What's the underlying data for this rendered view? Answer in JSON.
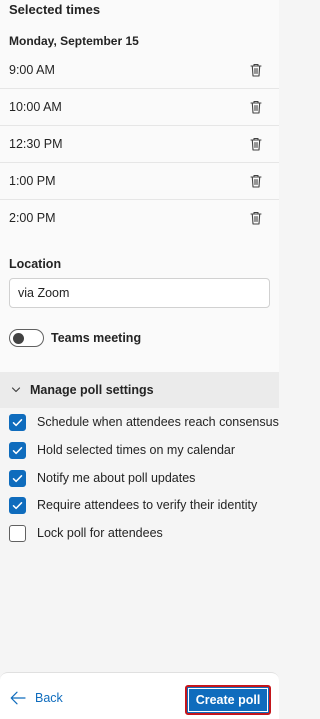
{
  "selected_times": {
    "title": "Selected times",
    "date": "Monday, September 15",
    "times": [
      "9:00 AM",
      "10:00 AM",
      "12:30 PM",
      "1:00 PM",
      "2:00 PM"
    ],
    "remove_icon": "trash-icon"
  },
  "location": {
    "label": "Location",
    "value": "via Zoom"
  },
  "teams_meeting": {
    "label": "Teams meeting",
    "enabled": false
  },
  "poll_settings": {
    "header": "Manage poll settings",
    "expanded": true,
    "options": [
      {
        "label": "Schedule when attendees reach consensus",
        "checked": true
      },
      {
        "label": "Hold selected times on my calendar",
        "checked": true
      },
      {
        "label": "Notify me about poll updates",
        "checked": true
      },
      {
        "label": "Require attendees to verify their identity",
        "checked": true
      },
      {
        "label": "Lock poll for attendees",
        "checked": false
      }
    ]
  },
  "footer": {
    "back_label": "Back",
    "create_label": "Create poll"
  },
  "colors": {
    "accent": "#0f6cbd",
    "focus_outline": "#c4161c"
  }
}
